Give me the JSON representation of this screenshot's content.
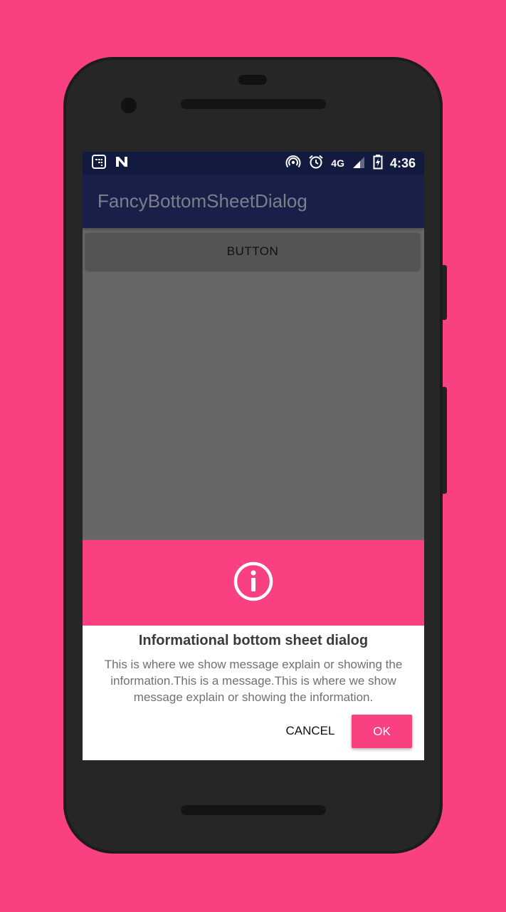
{
  "status_bar": {
    "network": "4G",
    "time": "4:36",
    "icons": [
      "screenshot-icon",
      "n-icon",
      "hotspot-icon",
      "alarm-icon",
      "signal-icon",
      "battery-icon"
    ]
  },
  "app_bar": {
    "title": "FancyBottomSheetDialog"
  },
  "main": {
    "button_label": "BUTTON"
  },
  "dialog": {
    "icon": "info-icon",
    "title": "Informational bottom sheet dialog",
    "message": "This is where we show message explain or showing the information.This is a message.This is where we show message explain or showing the information.",
    "cancel_label": "CANCEL",
    "ok_label": "OK"
  },
  "colors": {
    "background": "#f94080",
    "accent": "#f94080",
    "status_bar": "#131a40",
    "app_bar": "#18204a",
    "scrim": "#676767"
  }
}
